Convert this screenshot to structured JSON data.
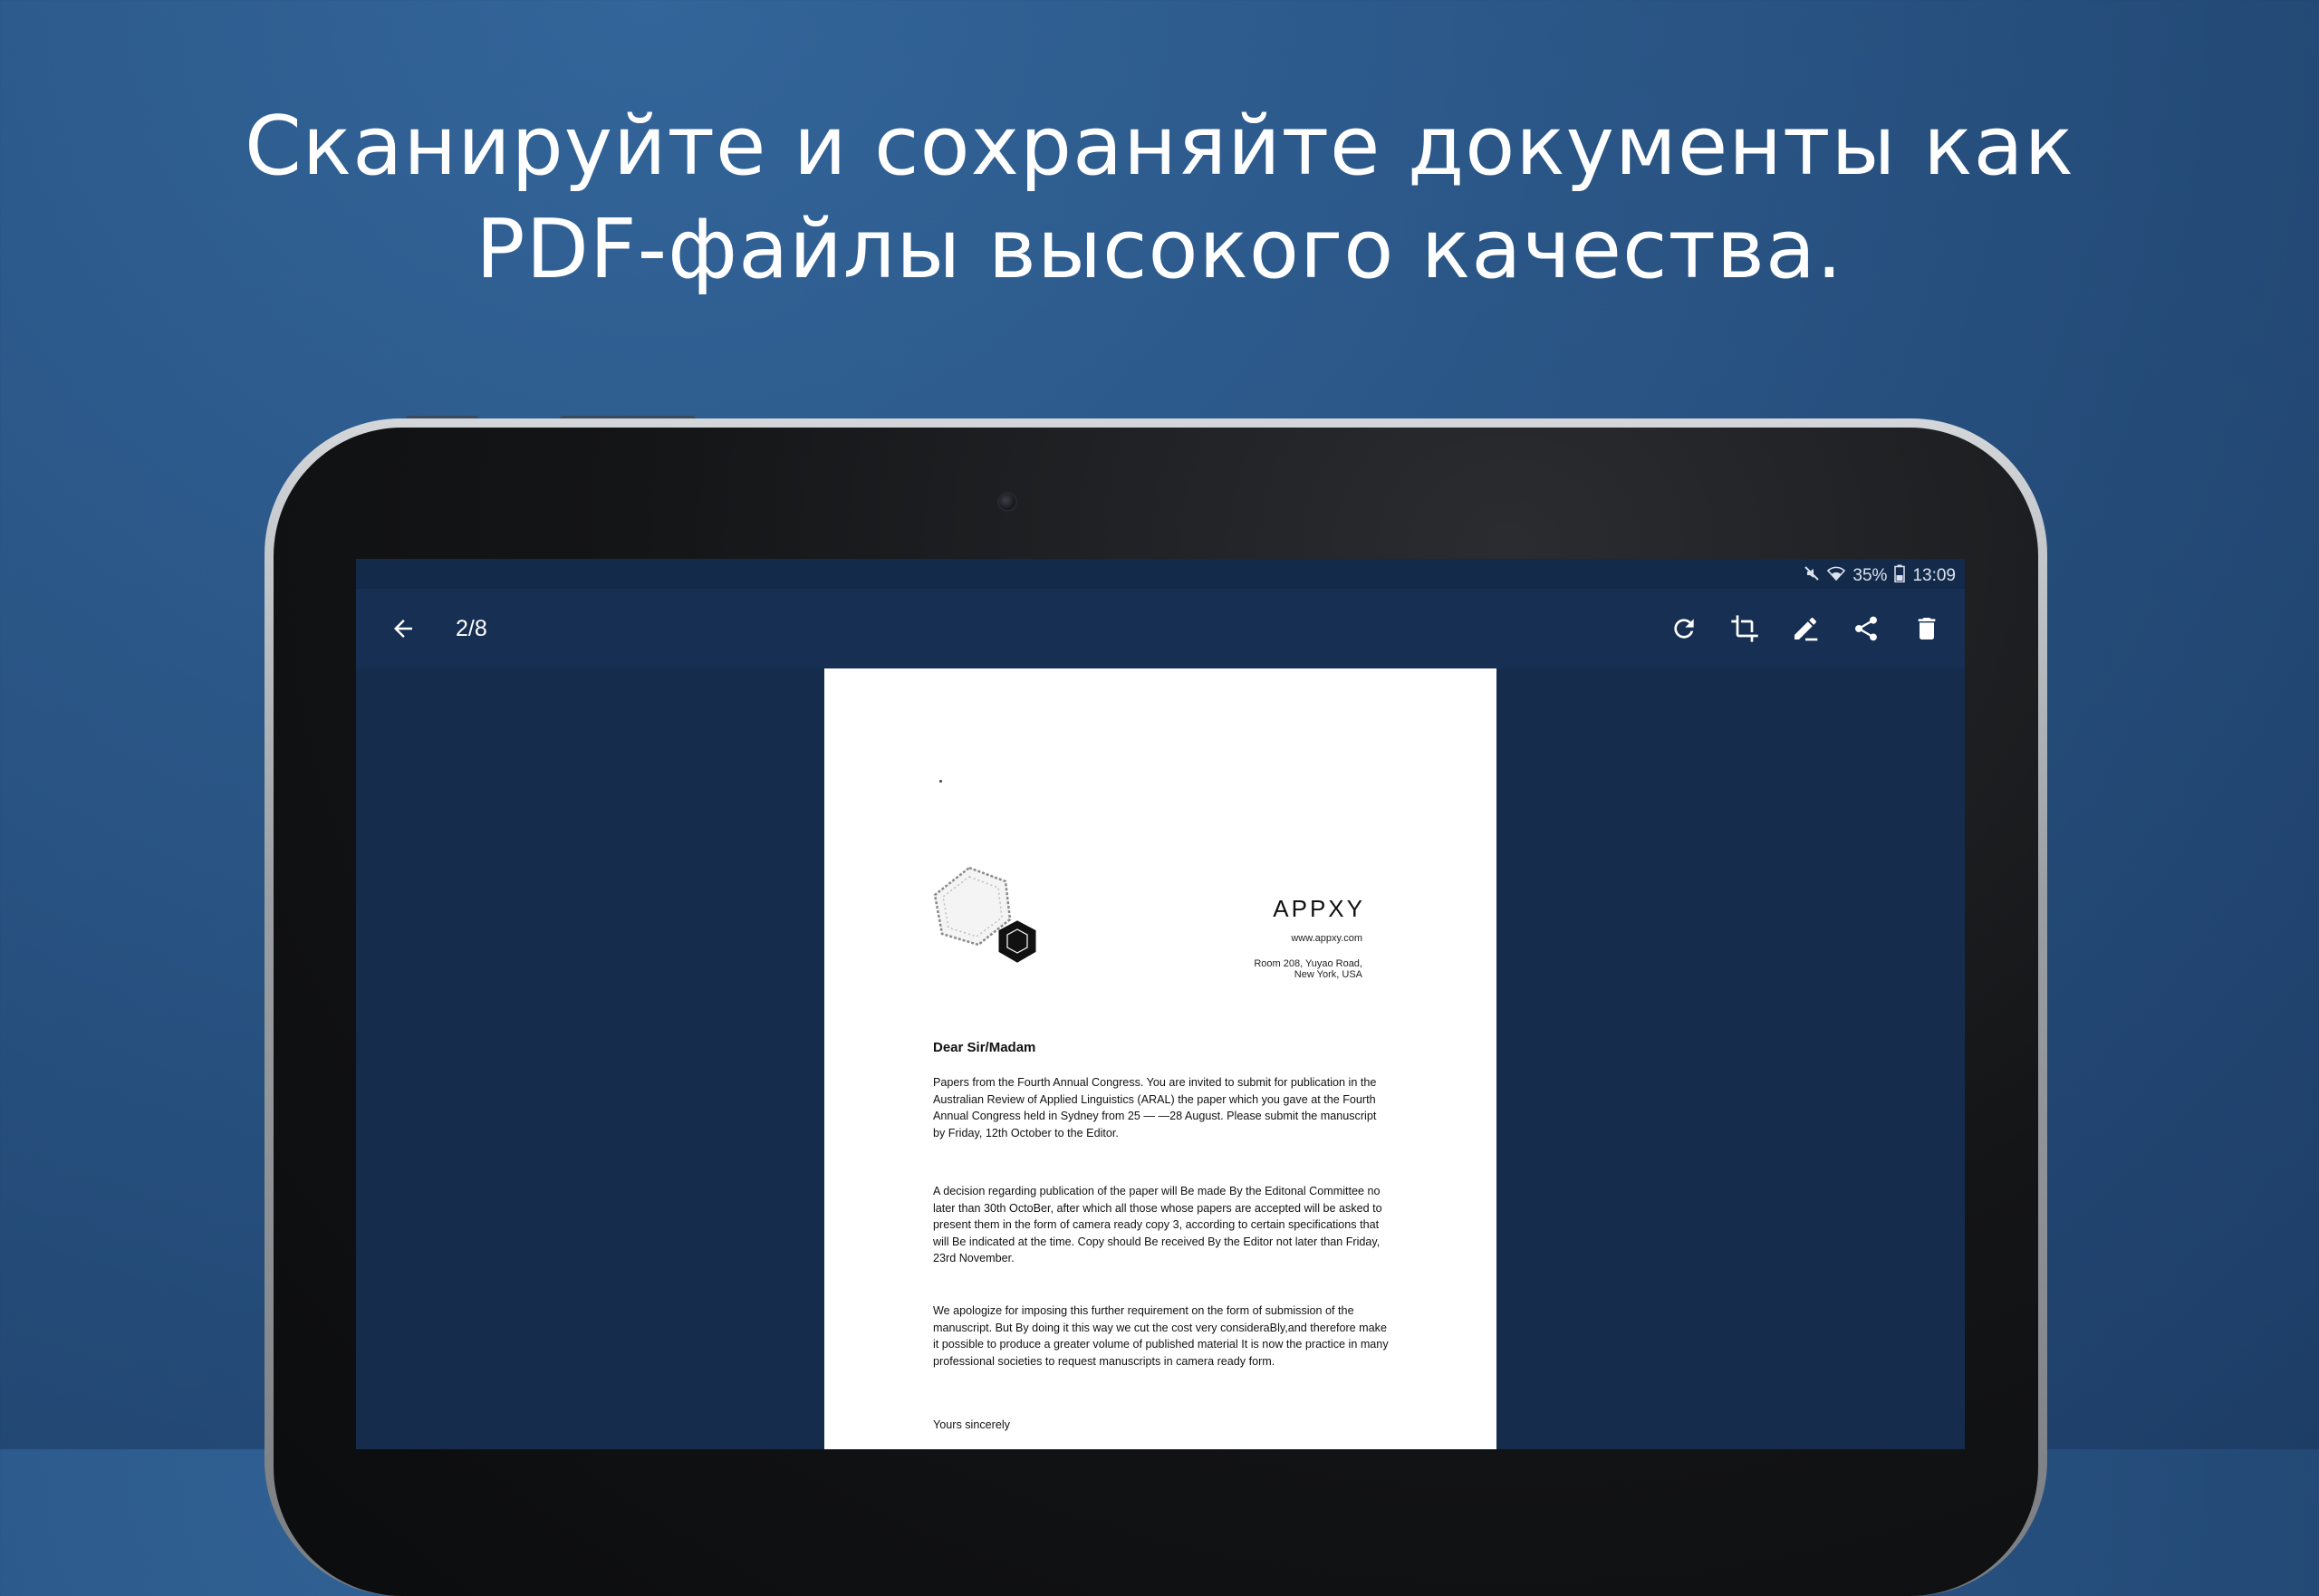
{
  "headline": {
    "line1": "Сканируйте и сохраняйте документы как",
    "line2": "PDF-файлы высокого качества."
  },
  "status_bar": {
    "mute_icon": "mute-icon",
    "wifi_icon": "wifi-icon",
    "battery_percent": "35%",
    "battery_icon": "battery-icon",
    "time": "13:09"
  },
  "toolbar": {
    "back_icon": "arrow-left-icon",
    "page_counter": "2/8",
    "actions": [
      "rotate-icon",
      "crop-icon",
      "edit-icon",
      "share-icon",
      "delete-icon"
    ]
  },
  "document": {
    "brand": "APPXY",
    "website": "www.appxy.com",
    "address_line1": "Room 208, Yuyao Road,",
    "address_line2": "New York, USA",
    "salutation": "Dear Sir/Madam",
    "paragraph1": "Papers from the Fourth Annual Congress. You are invited to submit for publication in the Australian Review of Applied Linguistics (ARAL) the paper which you gave at the Fourth Annual Congress held in Sydney from 25 — —28 August. Please submit the manuscript by Friday, 12th October to the Editor.",
    "paragraph2": "A decision regarding publication of the paper will Be made By the Editonal Committee no later than 30th OctoBer, after which all those whose papers are accepted will be asked to present them in the form of camera ready copy 3, according to certain specifications that will Be indicated at the time. Copy should Be received By the Editor not later than Friday, 23rd November.",
    "paragraph3": "We apologize for imposing this further requirement on the form of submission of the manuscript. But By doing it this way we cut the cost very consideraBly,and therefore make it possible to produce a greater volume of published material It is now the practice in many professional societies to request manuscripts in camera ready form.",
    "closing": "Yours sincerely"
  },
  "colors": {
    "background": "#295484",
    "screen": "#152c4d",
    "toolbar": "#162f52",
    "page": "#ffffff"
  }
}
